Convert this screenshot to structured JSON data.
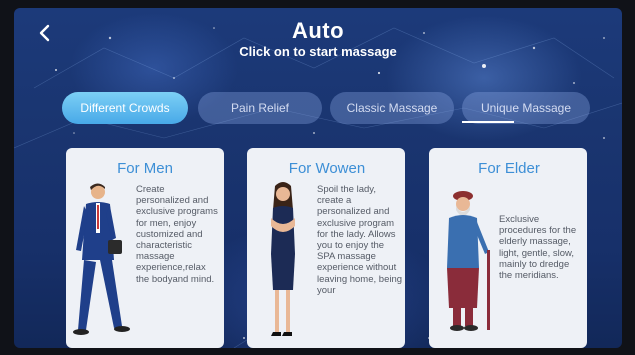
{
  "header": {
    "title": "Auto",
    "subtitle": "Click on to start massage",
    "back_icon": "chevron-left-icon"
  },
  "tabs": [
    {
      "label": "Different Crowds",
      "active": true
    },
    {
      "label": "Pain Relief",
      "active": false
    },
    {
      "label": "Classic Massage",
      "active": false
    },
    {
      "label": "Unique Massage",
      "active": false
    }
  ],
  "cards": [
    {
      "title": "For Men",
      "description": "Create personalized and exclusive programs for men, enjoy customized and characteristic massage experience,relax the bodyand mind."
    },
    {
      "title": "For Wowen",
      "description": "Spoil the lady, create a personalized and exclusive program for the lady. Allows you to enjoy the SPA massage experience without leaving home, being your"
    },
    {
      "title": "For Elder",
      "description": "Exclusive procedures for the elderly massage, light, gentle, slow, mainly to dredge the meridians."
    }
  ],
  "colors": {
    "active_tab": "#5bb8ee",
    "card_title": "#3d8fd6",
    "background": "#1a3570"
  }
}
